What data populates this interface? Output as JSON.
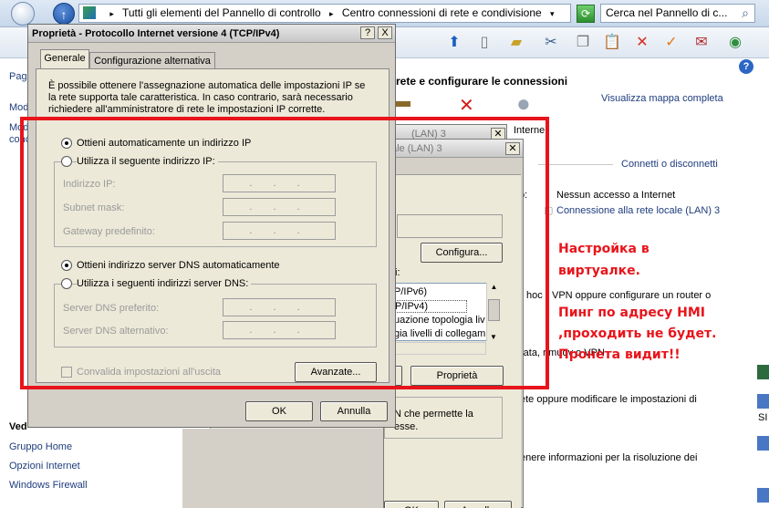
{
  "address_bar": {
    "segments": [
      "Tutti gli elementi del Pannello di controllo",
      "Centro connessioni di rete e condivisione"
    ],
    "search_placeholder": "Cerca nel Pannello di c..."
  },
  "left_pane": {
    "items_top": [
      "Pagi",
      "Mod",
      "Mod",
      "conc"
    ],
    "see_also_title": "Ved",
    "see_also": [
      "Gruppo Home",
      "Opzioni Internet",
      "Windows Firewall"
    ]
  },
  "main_pane": {
    "heading": "rete e configurare le connessioni",
    "view_map_link": "Visualizza mappa completa",
    "internet_label": "Interne",
    "connect_link": "Connetti o disconnetti",
    "access_label": "o:",
    "access_value": "Nessun accesso a Internet",
    "conn_label": "i:",
    "conn_value": "Connessione alla rete locale (LAN) 3",
    "vpn_text": "VPN oppure configurare un router o",
    "hoc": "hoc",
    "rata_text": "rata, rimuov  o VPN",
    "modify_text": "ete oppure modificare le impostazioni di",
    "info_text": "enere informazioni per la risoluzione dei"
  },
  "lan_dialog": {
    "title_back": "(LAN) 3",
    "title_front": "ale (LAN) 3",
    "configure_button": "Configura...",
    "components_label": "i:",
    "list_items": [
      "P/IPv6)",
      "P/IPv4)",
      "uazione topologia liv",
      "gia livelli di collegam"
    ],
    "properties_button": "Proprietà",
    "desc_line1": "N che permette la",
    "desc_line2": "esse.",
    "ok_button": "OK",
    "cancel_button": "Annulla"
  },
  "properties_dialog": {
    "title": "Proprietà - Protocollo Internet versione 4 (TCP/IPv4)",
    "help_button": "?",
    "close_button": "X",
    "tabs": [
      "Generale",
      "Configurazione alternativa"
    ],
    "intro": "È possibile ottenere l'assegnazione automatica delle impostazioni IP se la rete supporta tale caratteristica. In caso contrario, sarà necessario richiedere all'amministratore di rete le impostazioni IP corrette.",
    "auto_ip": "Ottieni automaticamente un indirizzo IP",
    "manual_ip": "Utilizza il seguente indirizzo IP:",
    "ip_address": "Indirizzo IP:",
    "subnet": "Subnet mask:",
    "gateway": "Gateway predefinito:",
    "auto_dns": "Ottieni indirizzo server DNS automaticamente",
    "manual_dns": "Utilizza i seguenti indirizzi server DNS:",
    "dns_pref": "Server DNS preferito:",
    "dns_alt": "Server DNS alternativo:",
    "validate": "Convalida impostazioni all'uscita",
    "advanced": "Avanzate...",
    "ok": "OK",
    "cancel": "Annulla",
    "ip_placeholder": ". . ."
  },
  "annotation": {
    "lines": [
      "Настройка в",
      "виртуалке.",
      "Пинг по адресу HMI",
      ",проходить не будет.",
      "Пронета видит!!"
    ],
    "color": "#e8141b"
  },
  "desktop": {
    "label": "SI"
  }
}
